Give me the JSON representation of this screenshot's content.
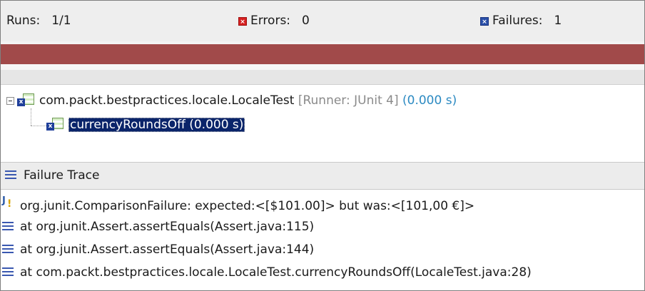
{
  "counters": {
    "runs_label": "Runs:",
    "runs_value": "1/1",
    "errors_label": "Errors:",
    "errors_value": "0",
    "failures_label": "Failures:",
    "failures_value": "1"
  },
  "progress": {
    "status": "failed",
    "color": "#a14a4a",
    "fraction": 1.0
  },
  "tree": {
    "suite": {
      "name": "com.packt.bestpractices.locale.LocaleTest",
      "runner": "[Runner: JUnit 4]",
      "time": "(0.000 s)"
    },
    "test": {
      "name": "currencyRoundsOff (0.000 s)"
    }
  },
  "trace": {
    "title": "Failure Trace",
    "lines": [
      "org.junit.ComparisonFailure: expected:<[$101.00]> but was:<[101,00 €]>",
      "at org.junit.Assert.assertEquals(Assert.java:115)",
      "at org.junit.Assert.assertEquals(Assert.java:144)",
      "at com.packt.bestpractices.locale.LocaleTest.currencyRoundsOff(LocaleTest.java:28)"
    ]
  },
  "icons": {
    "errors": "error-icon",
    "failures": "failure-icon",
    "suite": "test-suite-icon",
    "test": "test-case-icon",
    "trace": "stack-lines-icon",
    "exception": "junit-exception-icon"
  }
}
